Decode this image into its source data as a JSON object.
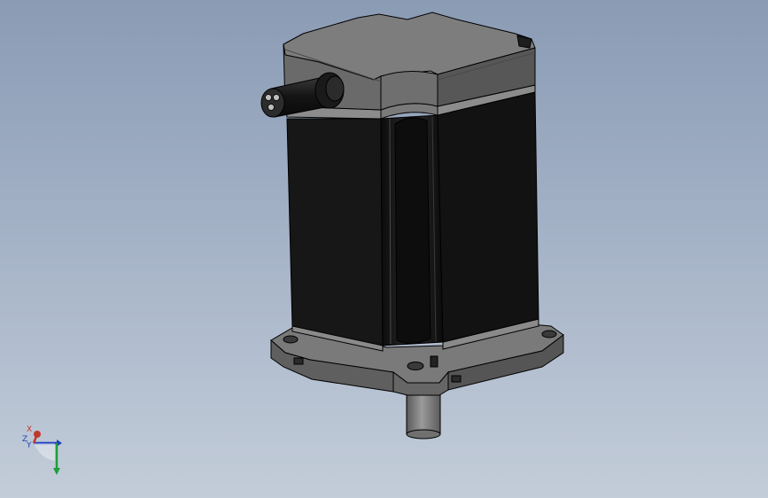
{
  "viewport": {
    "background_top": "#8a9bb4",
    "background_bottom": "#c3cdd9"
  },
  "model": {
    "body_color": "#161616",
    "flange_color": "#6b6b6b",
    "edge_color": "#000000",
    "shaft_color": "#7c7c7c"
  },
  "triad": {
    "x_label": "X",
    "y_label": "Y",
    "z_label": "Z",
    "x_color": "#c0392b",
    "y_color": "#1e9e3a",
    "z_color": "#1f3fbf"
  }
}
